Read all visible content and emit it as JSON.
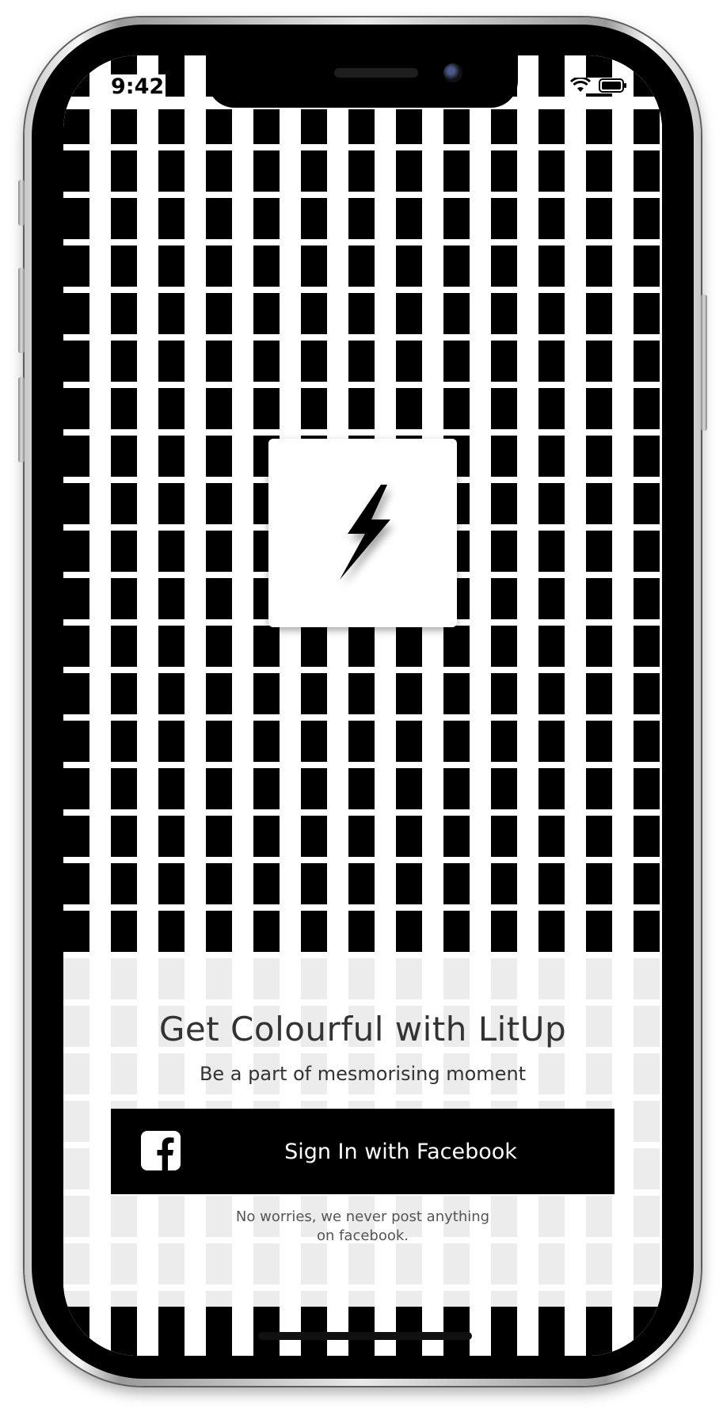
{
  "status_bar": {
    "time": "9:42"
  },
  "logo": {
    "icon": "lightning-bolt-icon"
  },
  "onboarding": {
    "headline": "Get Colourful with LitUp",
    "subheadline": "Be a part of mesmorising moment",
    "facebook_button_label": "Sign In with Facebook",
    "facebook_icon": "facebook-icon",
    "disclaimer_line1": "No worries, we never post anything",
    "disclaimer_line2": "on facebook."
  },
  "colors": {
    "primary": "#000000",
    "background": "#ffffff",
    "panel_tint": "#ececec",
    "text": "#333333"
  }
}
